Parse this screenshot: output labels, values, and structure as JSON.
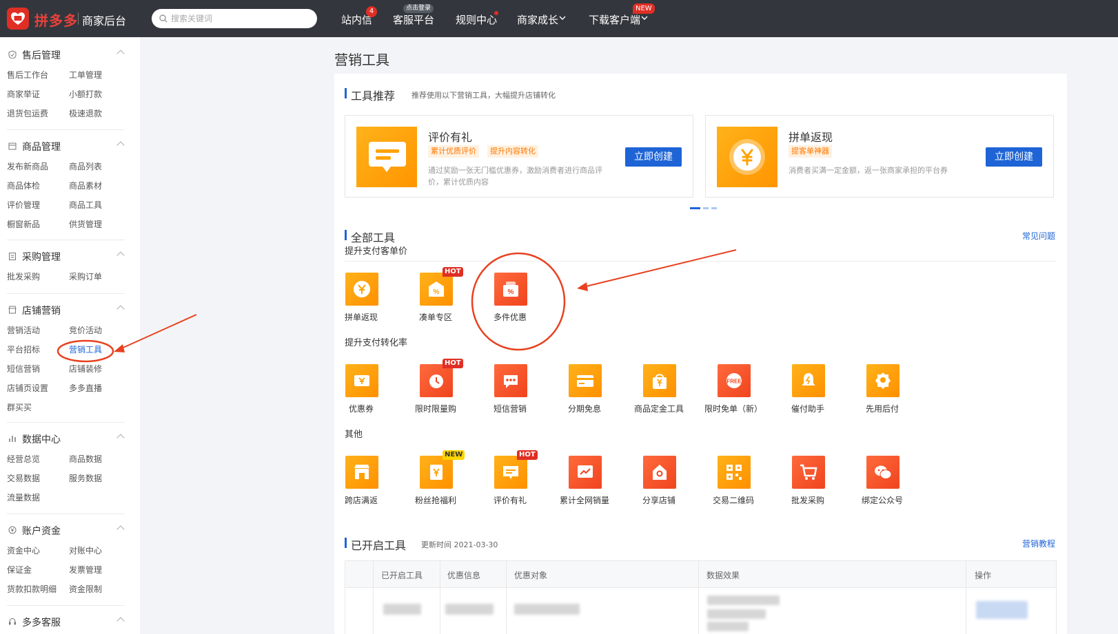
{
  "topbar": {
    "logo_text": "拼多多",
    "logo_sub": "商家后台",
    "search_placeholder": "搜索关键词",
    "nav": [
      {
        "label": "站内信",
        "badge": "4"
      },
      {
        "label": "客服平台",
        "pill": "点击登录"
      },
      {
        "label": "规则中心"
      },
      {
        "label": "商家成长"
      },
      {
        "label": "下载客户端",
        "pill": "NEW"
      }
    ]
  },
  "sidebar": {
    "sections": [
      {
        "title": "售后管理",
        "icon": "shield-check-icon",
        "links": [
          "售后工作台",
          "工单管理",
          "商家举证",
          "小额打款",
          "退货包运费",
          "极速退款"
        ]
      },
      {
        "title": "商品管理",
        "icon": "box-icon",
        "links": [
          "发布新商品",
          "商品列表",
          "商品体检",
          "商品素材",
          "评价管理",
          "商品工具",
          "橱窗新品",
          "供货管理"
        ]
      },
      {
        "title": "采购管理",
        "icon": "clipboard-icon",
        "links": [
          "批发采购",
          "采购订单"
        ]
      },
      {
        "title": "店铺营销",
        "icon": "shop-icon",
        "links": [
          "营销活动",
          "竞价活动",
          "平台招标",
          "营销工具",
          "短信营销",
          "店铺装修",
          "店铺页设置",
          "多多直播",
          "群买买"
        ]
      },
      {
        "title": "数据中心",
        "icon": "bar-chart-icon",
        "links": [
          "经营总览",
          "商品数据",
          "交易数据",
          "服务数据",
          "流量数据"
        ]
      },
      {
        "title": "账户资金",
        "icon": "yen-circle-icon",
        "links": [
          "资金中心",
          "对账中心",
          "保证金",
          "发票管理",
          "货款扣款明细",
          "资金限制"
        ]
      },
      {
        "title": "多多客服",
        "icon": "headset-icon",
        "links": []
      }
    ]
  },
  "main": {
    "page_title": "营销工具",
    "recommend": {
      "title": "工具推荐",
      "subtitle": "推荐使用以下营销工具，大幅提升店铺转化",
      "cards": [
        {
          "name": "评价有礼",
          "tags": [
            "累计优质评价",
            "提升内容转化"
          ],
          "desc": "通过奖励一张无门槛优惠券，激励消费者进行商品评价，累计优质内容",
          "button": "立即创建",
          "icon": "comment-card-icon"
        },
        {
          "name": "拼单返现",
          "tags": [
            "提客单神器"
          ],
          "desc": "消费者买满一定金额，返一张商家承担的平台券",
          "button": "立即创建",
          "icon": "yen-refresh-icon"
        }
      ]
    },
    "all_tools": {
      "title": "全部工具",
      "faq": "常见问题",
      "groups": [
        {
          "title": "提升支付客单价",
          "tools": [
            {
              "label": "拼单返现",
              "color": "orange",
              "icon": "yen-coin-icon"
            },
            {
              "label": "凑单专区",
              "color": "orange",
              "icon": "percent-box-icon",
              "badge": "HOT"
            },
            {
              "label": "多件优惠",
              "color": "red",
              "icon": "gift-percent-icon"
            }
          ]
        },
        {
          "title": "提升支付转化率",
          "tools": [
            {
              "label": "优惠券",
              "color": "orange",
              "icon": "coupon-icon"
            },
            {
              "label": "限时限量购",
              "color": "red",
              "icon": "alarm-clock-icon",
              "badge": "HOT"
            },
            {
              "label": "短信营销",
              "color": "red",
              "icon": "chat-bubble-icon"
            },
            {
              "label": "分期免息",
              "color": "orange",
              "icon": "credit-card-icon"
            },
            {
              "label": "商品定金工具",
              "color": "orange",
              "icon": "shopping-bag-icon"
            },
            {
              "label": "限时免单（新）",
              "color": "red",
              "icon": "free-tag-icon"
            },
            {
              "label": "催付助手",
              "color": "orange",
              "icon": "bell-icon"
            },
            {
              "label": "先用后付",
              "color": "orange",
              "icon": "badge-icon"
            }
          ]
        },
        {
          "title": "其他",
          "tools": [
            {
              "label": "跨店满返",
              "color": "orange",
              "icon": "store-icon"
            },
            {
              "label": "粉丝抢福利",
              "color": "orange",
              "icon": "envelope-yen-icon",
              "badge": "NEW"
            },
            {
              "label": "评价有礼",
              "color": "orange",
              "icon": "comment-icon",
              "badge": "HOT"
            },
            {
              "label": "累计全网销量",
              "color": "red",
              "icon": "trend-chart-icon"
            },
            {
              "label": "分享店铺",
              "color": "red",
              "icon": "share-shop-icon"
            },
            {
              "label": "交易二维码",
              "color": "orange",
              "icon": "qr-code-icon"
            },
            {
              "label": "批发采购",
              "color": "red",
              "icon": "cart-icon"
            },
            {
              "label": "绑定公众号",
              "color": "red",
              "icon": "wechat-icon"
            }
          ]
        }
      ]
    },
    "enabled": {
      "title": "已开启工具",
      "update": "更新时间 2021-03-30",
      "link": "营销教程",
      "columns": [
        "已开启工具",
        "优惠信息",
        "优惠对象",
        "数据效果",
        "操作"
      ]
    }
  },
  "colors": {
    "topbar": "#33373d",
    "accent": "#1e64d6",
    "brand_red": "#e02e24",
    "annotation": "#e8411f"
  }
}
